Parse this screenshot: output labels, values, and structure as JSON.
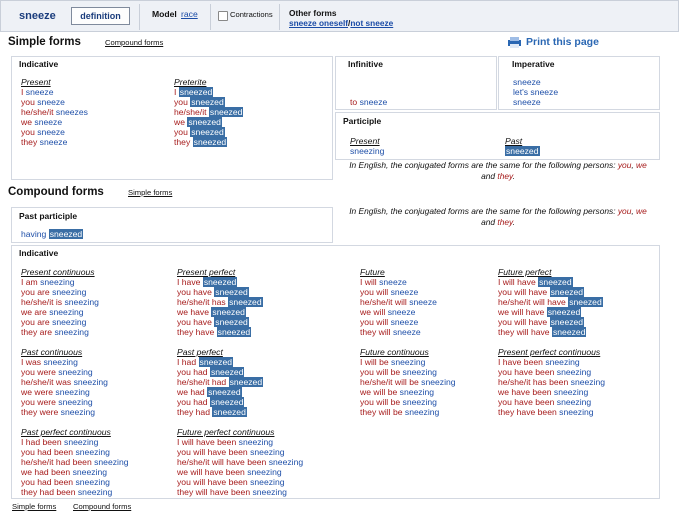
{
  "topbar": {
    "verb": "sneeze",
    "definition_btn": "definition",
    "model_label": "Model",
    "model_link": "race",
    "contractions_label": "Contractions",
    "other_forms_label": "Other forms",
    "other_form_1": "sneeze oneself",
    "other_form_sep": "/",
    "other_form_2": "not sneeze"
  },
  "simple": {
    "title": "Simple forms",
    "compound_link": "Compound forms",
    "print": "Print this page",
    "indicative_title": "Indicative",
    "present_title": "Present",
    "present": [
      [
        "I",
        "sneeze"
      ],
      [
        "you",
        "sneeze"
      ],
      [
        "he/she/it",
        "sneezes"
      ],
      [
        "we",
        "sneeze"
      ],
      [
        "you",
        "sneeze"
      ],
      [
        "they",
        "sneeze"
      ]
    ],
    "preterite_title": "Preterite",
    "preterite": [
      [
        "I",
        "sneezed"
      ],
      [
        "you",
        "sneezed"
      ],
      [
        "he/she/it",
        "sneezed"
      ],
      [
        "we",
        "sneezed"
      ],
      [
        "you",
        "sneezed"
      ],
      [
        "they",
        "sneezed"
      ]
    ],
    "infinitive_title": "Infinitive",
    "infinitive_pronoun": "to",
    "infinitive_verb": "sneeze",
    "imperative_title": "Imperative",
    "imperative": [
      "sneeze",
      "let's sneeze",
      "sneeze"
    ],
    "participle_title": "Participle",
    "part_present_title": "Present",
    "part_present": "sneezing",
    "part_past_title": "Past",
    "part_past": "sneezed",
    "note_a": "In English, the conjugated forms are the same for the following persons:",
    "note_you": "you",
    "note_comma": ",",
    "note_we": "we",
    "note_and": "and",
    "note_they": "they",
    "note_dot": "."
  },
  "compound": {
    "title": "Compound forms",
    "simple_link": "Simple forms",
    "past_participle_title": "Past participle",
    "having": "having",
    "having_verb": "sneezed",
    "indicative_title": "Indicative",
    "present_continuous_title": "Present continuous",
    "present_continuous": [
      [
        "I am",
        "sneezing"
      ],
      [
        "you are",
        "sneezing"
      ],
      [
        "he/she/it is",
        "sneezing"
      ],
      [
        "we are",
        "sneezing"
      ],
      [
        "you are",
        "sneezing"
      ],
      [
        "they are",
        "sneezing"
      ]
    ],
    "present_perfect_title": "Present perfect",
    "present_perfect": [
      [
        "I have",
        "sneezed"
      ],
      [
        "you have",
        "sneezed"
      ],
      [
        "he/she/it has",
        "sneezed"
      ],
      [
        "we have",
        "sneezed"
      ],
      [
        "you have",
        "sneezed"
      ],
      [
        "they have",
        "sneezed"
      ]
    ],
    "future_title": "Future",
    "future": [
      [
        "I will",
        "sneeze"
      ],
      [
        "you will",
        "sneeze"
      ],
      [
        "he/she/it will",
        "sneeze"
      ],
      [
        "we will",
        "sneeze"
      ],
      [
        "you will",
        "sneeze"
      ],
      [
        "they will",
        "sneeze"
      ]
    ],
    "future_perfect_title": "Future perfect",
    "future_perfect": [
      [
        "I will have",
        "sneezed"
      ],
      [
        "you will have",
        "sneezed"
      ],
      [
        "he/she/it will have",
        "sneezed"
      ],
      [
        "we will have",
        "sneezed"
      ],
      [
        "you will have",
        "sneezed"
      ],
      [
        "they will have",
        "sneezed"
      ]
    ],
    "past_continuous_title": "Past continuous",
    "past_continuous": [
      [
        "I was",
        "sneezing"
      ],
      [
        "you were",
        "sneezing"
      ],
      [
        "he/she/it was",
        "sneezing"
      ],
      [
        "we were",
        "sneezing"
      ],
      [
        "you were",
        "sneezing"
      ],
      [
        "they were",
        "sneezing"
      ]
    ],
    "past_perfect_title": "Past perfect",
    "past_perfect": [
      [
        "I had",
        "sneezed"
      ],
      [
        "you had",
        "sneezed"
      ],
      [
        "he/she/it had",
        "sneezed"
      ],
      [
        "we had",
        "sneezed"
      ],
      [
        "you had",
        "sneezed"
      ],
      [
        "they had",
        "sneezed"
      ]
    ],
    "future_continuous_title": "Future continuous",
    "future_continuous": [
      [
        "I will be",
        "sneezing"
      ],
      [
        "you will be",
        "sneezing"
      ],
      [
        "he/she/it will be",
        "sneezing"
      ],
      [
        "we will be",
        "sneezing"
      ],
      [
        "you will be",
        "sneezing"
      ],
      [
        "they will be",
        "sneezing"
      ]
    ],
    "present_perfect_continuous_title": "Present perfect continuous",
    "present_perfect_continuous": [
      [
        "I have been",
        "sneezing"
      ],
      [
        "you have been",
        "sneezing"
      ],
      [
        "he/she/it has been",
        "sneezing"
      ],
      [
        "we have been",
        "sneezing"
      ],
      [
        "you have been",
        "sneezing"
      ],
      [
        "they have been",
        "sneezing"
      ]
    ],
    "past_perfect_continuous_title": "Past perfect continuous",
    "past_perfect_continuous": [
      [
        "I had been",
        "sneezing"
      ],
      [
        "you had been",
        "sneezing"
      ],
      [
        "he/she/it had been",
        "sneezing"
      ],
      [
        "we had been",
        "sneezing"
      ],
      [
        "you had been",
        "sneezing"
      ],
      [
        "they had been",
        "sneezing"
      ]
    ],
    "future_perfect_continuous_title": "Future perfect continuous",
    "future_perfect_continuous": [
      [
        "I will have been",
        "sneezing"
      ],
      [
        "you will have been",
        "sneezing"
      ],
      [
        "he/she/it will have been",
        "sneezing"
      ],
      [
        "we will have been",
        "sneezing"
      ],
      [
        "you will have been",
        "sneezing"
      ],
      [
        "they will have been",
        "sneezing"
      ]
    ]
  },
  "footer": {
    "simple": "Simple forms",
    "compound": "Compound forms"
  }
}
